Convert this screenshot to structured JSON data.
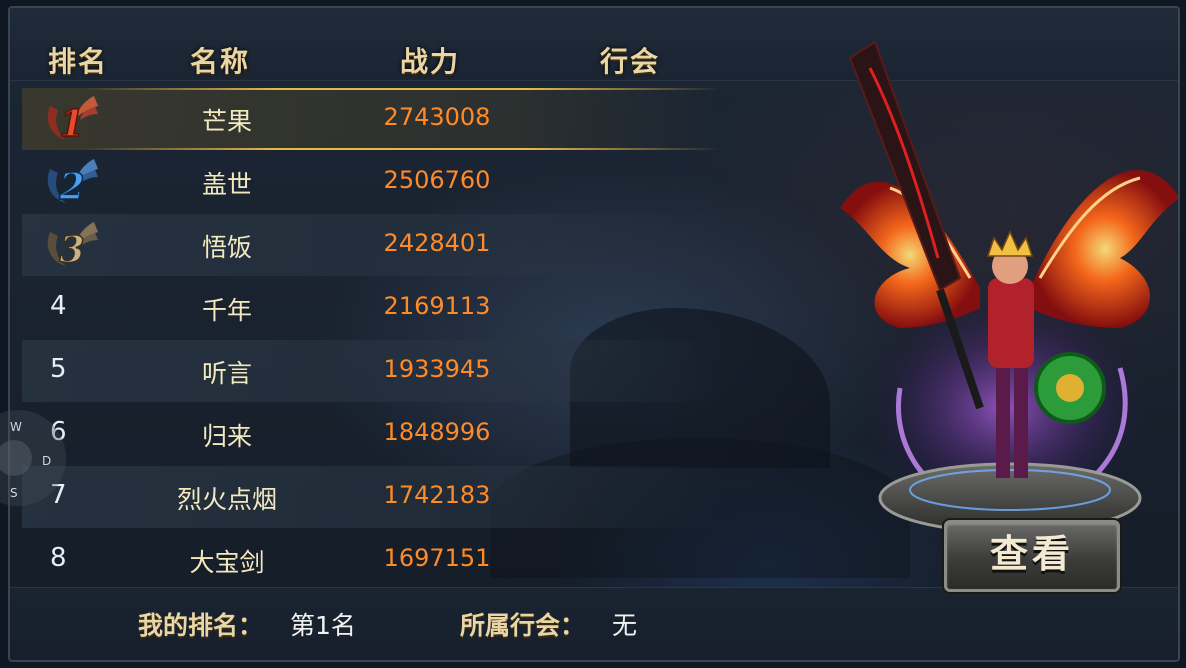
{
  "header": {
    "col_rank": "排名",
    "col_name": "名称",
    "col_power": "战力",
    "col_guild": "行会"
  },
  "rows": [
    {
      "rank": "1",
      "name": "芒果",
      "power": "2743008"
    },
    {
      "rank": "2",
      "name": "盖世",
      "power": "2506760"
    },
    {
      "rank": "3",
      "name": "悟饭",
      "power": "2428401"
    },
    {
      "rank": "4",
      "name": "千年",
      "power": "2169113"
    },
    {
      "rank": "5",
      "name": "听言",
      "power": "1933945"
    },
    {
      "rank": "6",
      "name": "归来",
      "power": "1848996"
    },
    {
      "rank": "7",
      "name": "烈火点烟",
      "power": "1742183"
    },
    {
      "rank": "8",
      "name": "大宝剑",
      "power": "1697151"
    }
  ],
  "footer": {
    "my_rank_label": "我的排名：",
    "my_rank_value": "第1名",
    "guild_label": "所属行会：",
    "guild_value": "无"
  },
  "view_button": "查看",
  "joystick": {
    "w": "W",
    "d": "D",
    "s": "S"
  },
  "colors": {
    "gold_text": "#e8d6a6",
    "name_text": "#f3e9bf",
    "power_text": "#ff8a28",
    "highlight": "#e5b84a"
  }
}
